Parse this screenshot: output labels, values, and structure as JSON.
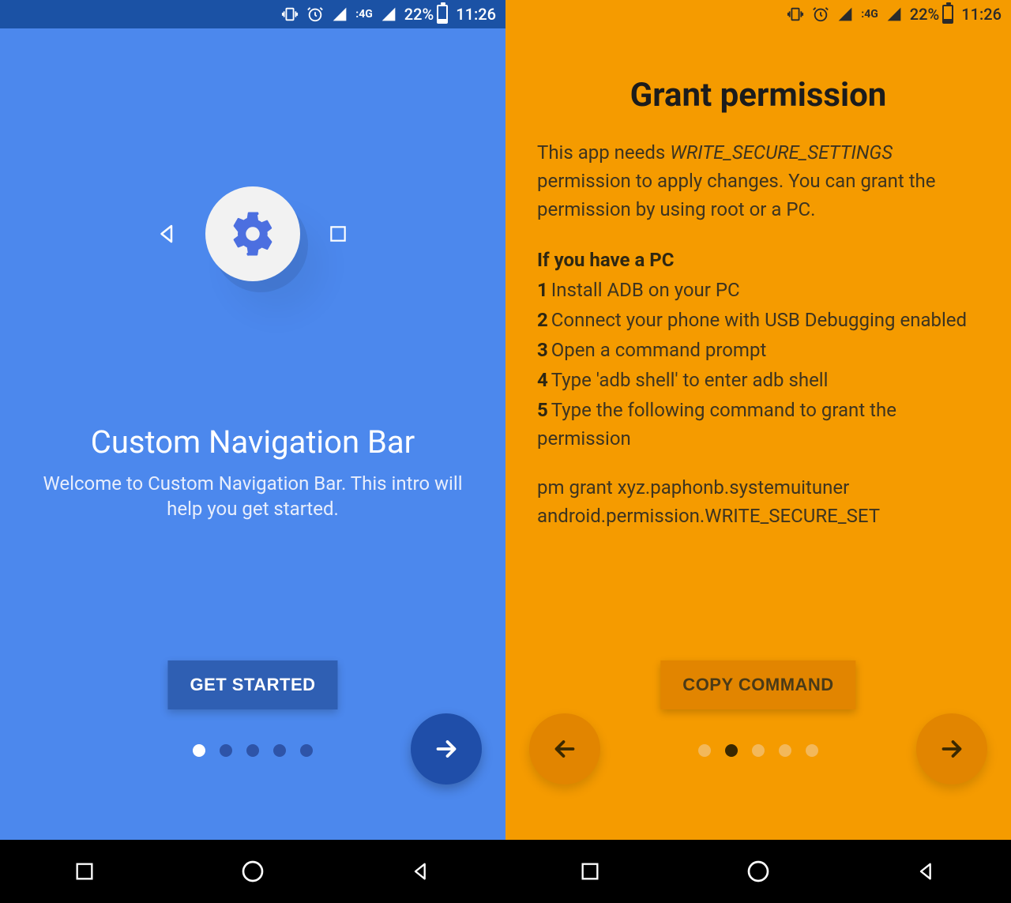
{
  "status": {
    "battery_pct": "22%",
    "time": "11:26",
    "network_label": "4G"
  },
  "left": {
    "title": "Custom Navigation Bar",
    "subtitle": "Welcome to Custom Navigation Bar. This intro will help you get started.",
    "cta": "GET STARTED",
    "page_count": 5,
    "active_page": 1
  },
  "right": {
    "title": "Grant permission",
    "intro_pre": "This app needs ",
    "intro_perm": "WRITE_SECURE_SETTINGS",
    "intro_post": " permission to apply changes. You can grant the permission by using root or a PC.",
    "pc_heading": "If you have a PC",
    "steps": [
      "Install ADB on your PC",
      "Connect your phone with USB Debugging enabled",
      "Open a command prompt",
      "Type 'adb shell' to enter adb shell",
      "Type the following command to grant the permission"
    ],
    "command_line1": "pm grant xyz.paphonb.systemuituner",
    "command_line2": "android.permission.WRITE_SECURE_SET",
    "cta": "COPY COMMAND",
    "page_count": 5,
    "active_page": 2
  }
}
